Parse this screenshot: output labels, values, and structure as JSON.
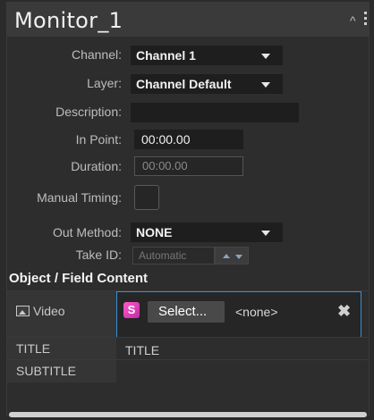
{
  "panel": {
    "title": "Monitor_1"
  },
  "fields": {
    "channel": {
      "label": "Channel:",
      "value": "Channel 1"
    },
    "layer": {
      "label": "Layer:",
      "value": "Channel Default"
    },
    "description": {
      "label": "Description:",
      "value": ""
    },
    "in_point": {
      "label": "In Point:",
      "value": "00:00.00"
    },
    "duration": {
      "label": "Duration:",
      "value": "00:00.00"
    },
    "manual_timing": {
      "label": "Manual Timing:",
      "checked": false
    },
    "out_method": {
      "label": "Out Method:",
      "value": "NONE"
    },
    "take_id": {
      "label": "Take ID:",
      "placeholder": "Automatic"
    }
  },
  "content": {
    "header": "Object / Field Content",
    "video": {
      "label": "Video",
      "select_label": "Select...",
      "value": "<none>"
    },
    "rows": [
      {
        "label": "TITLE",
        "value": "TITLE"
      },
      {
        "label": "SUBTITLE",
        "value": ""
      }
    ]
  }
}
